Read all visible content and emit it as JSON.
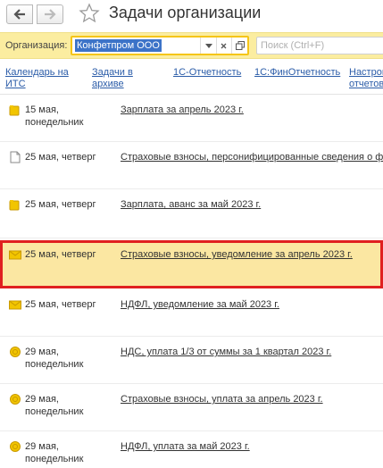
{
  "window": {
    "title": "Задачи организации",
    "back_icon": "arrow-left-icon",
    "forward_icon": "arrow-right-icon",
    "favorite_icon": "star-icon"
  },
  "filter": {
    "organization_label": "Организация:",
    "organization_value": "Конфетпром ООО",
    "search_placeholder": "Поиск (Ctrl+F)"
  },
  "links": [
    {
      "label": "Календарь на\nИТС"
    },
    {
      "label": "Задачи в\nархиве"
    },
    {
      "label": "1С-Отчетность"
    },
    {
      "label": "1С:ФинОтчетность"
    },
    {
      "label": "Настрой\nотчетов"
    }
  ],
  "tasks": [
    {
      "icon": "folder-bell-icon",
      "date": "15 мая,\nпонедельник",
      "name": "Зарплата за апрель 2023 г.",
      "selected": false
    },
    {
      "icon": "document-icon",
      "date": "25 мая, четверг",
      "name": "Страховые взносы, персонифицированные сведения о ф",
      "selected": false
    },
    {
      "icon": "folder-bell-icon",
      "date": "25 мая, четверг",
      "name": "Зарплата, аванс за май 2023 г.",
      "selected": false
    },
    {
      "icon": "envelope-icon",
      "date": "25 мая, четверг",
      "name": "Страховые взносы, уведомление за апрель 2023 г.",
      "selected": true
    },
    {
      "icon": "envelope-icon",
      "date": "25 мая, четверг",
      "name": "НДФЛ, уведомление за май 2023 г.",
      "selected": false
    },
    {
      "icon": "coin-icon",
      "date": "29 мая,\nпонедельник",
      "name": "НДС, уплата 1/3 от суммы за 1 квартал 2023 г.",
      "selected": false
    },
    {
      "icon": "coin-icon",
      "date": "29 мая,\nпонедельник",
      "name": "Страховые взносы, уплата за апрель 2023 г.",
      "selected": false
    },
    {
      "icon": "coin-icon",
      "date": "29 мая,\nпонедельник",
      "name": "НДФЛ, уплата за май 2023 г.",
      "selected": false
    }
  ],
  "colors": {
    "filter_bg": "#fbeda0",
    "selected_bg": "#fbe7a2",
    "selection_border": "#e02020",
    "link": "#2b5ca8"
  }
}
